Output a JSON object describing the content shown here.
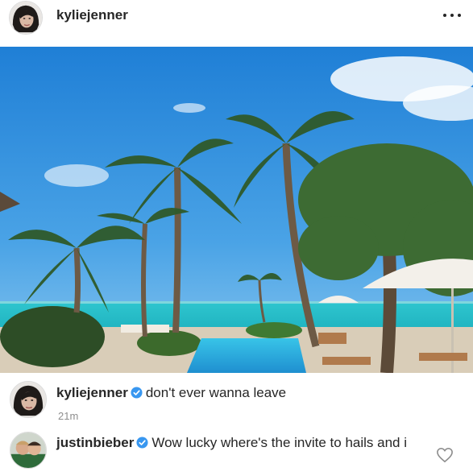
{
  "header": {
    "username": "kyliejenner",
    "more_icon": "more-horizontal-icon"
  },
  "post": {
    "image": "tropical-resort-pool-palm-trees-ocean"
  },
  "comments": [
    {
      "username": "kyliejenner",
      "verified": true,
      "text": "don't ever wanna leave",
      "time": "21m"
    },
    {
      "username": "justinbieber",
      "verified": true,
      "text": "Wow lucky where's the invite to hails and i",
      "like_icon": "heart-outline-icon"
    }
  ],
  "colors": {
    "verified_blue": "#3897f0",
    "text": "#262626",
    "muted": "#8e8e8e"
  }
}
